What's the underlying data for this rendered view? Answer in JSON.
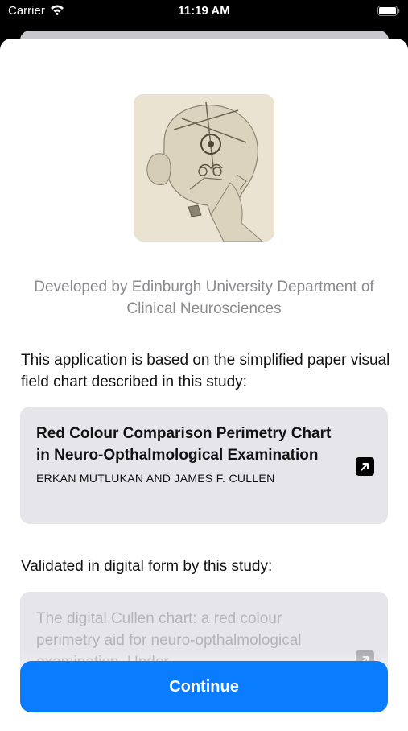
{
  "status_bar": {
    "carrier": "Carrier",
    "time": "11:19 AM"
  },
  "about": {
    "credit": "Developed by Edinburgh University Department of Clinical Neurosciences",
    "intro": "This application is based on the simplified paper visual field chart described in this study:",
    "validated_label": "Validated in digital form by this study:"
  },
  "studies": [
    {
      "title": "Red Colour Comparison Perimetry Chart in Neuro-Opthalmological Examination",
      "authors": "ERKAN MUTLUKAN AND JAMES F. CULLEN",
      "link_icon": "external-link-icon"
    },
    {
      "title": "The digital Cullen chart: a red colour perimetry aid for neuro-opthalmological examination. Under",
      "link_icon": "external-link-icon"
    }
  ],
  "footer": {
    "continue_label": "Continue"
  },
  "colors": {
    "accent": "#0a7cff",
    "card_background": "#e6e6ea",
    "secondary_text": "#8a8a8e"
  }
}
